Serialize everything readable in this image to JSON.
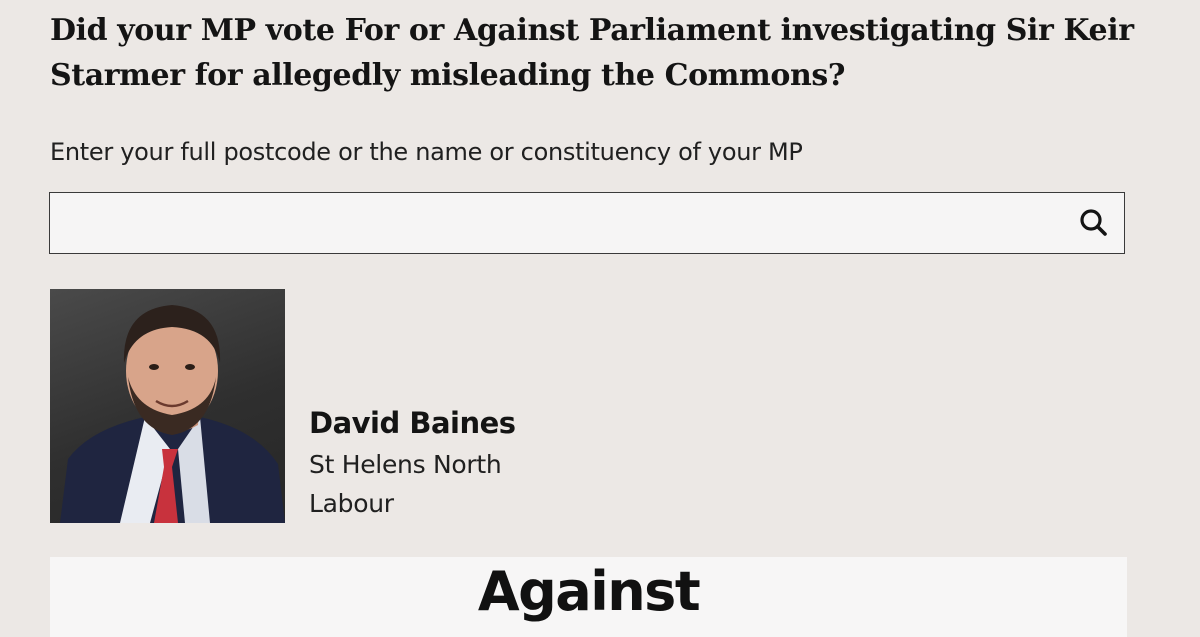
{
  "question": "Did your MP vote For or Against Parliament investigating Sir Keir Starmer for allegedly misleading the Commons?",
  "search": {
    "prompt": "Enter your full postcode or the name or constituency of your MP",
    "value": "",
    "placeholder": "",
    "button_icon": "search-icon"
  },
  "mp": {
    "photo_icon": "mp-portrait",
    "name": "David Baines",
    "constituency": "St Helens North",
    "party": "Labour"
  },
  "vote": {
    "result": "Against"
  },
  "colors": {
    "background": "#ece8e5",
    "panel": "#f7f6f6",
    "text": "#141414",
    "tie": "#c8323d"
  }
}
